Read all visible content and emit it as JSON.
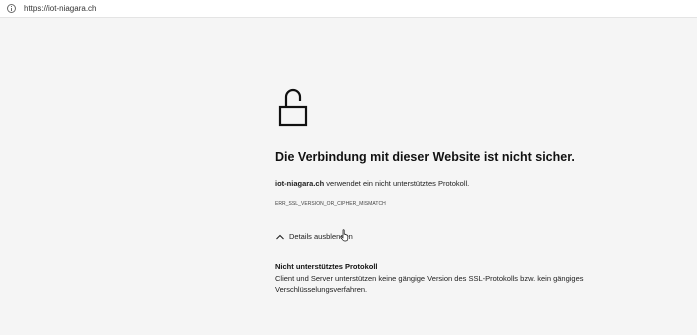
{
  "addressbar": {
    "url": "https://iot-niagara.ch",
    "icon": "info-icon"
  },
  "error": {
    "icon": "unlocked-padlock-icon",
    "title": "Die Verbindung mit dieser Website ist nicht sicher.",
    "host": "iot-niagara.ch",
    "description_rest": " verwendet ein nicht unterstütztes Protokoll.",
    "code": "ERR_SSL_VERSION_OR_CIPHER_MISMATCH",
    "details_toggle_label": "Details ausblenden",
    "details_toggle_icon": "chevron-up-icon",
    "details_title": "Nicht unterstütztes Protokoll",
    "details_body": "Client und Server unterstützen keine gängige Version des SSL-Protokolls bzw. kein gängiges Verschlüsselungsverfahren."
  },
  "colors": {
    "page_background": "#f5f5f5",
    "text": "#1a1a1a"
  }
}
